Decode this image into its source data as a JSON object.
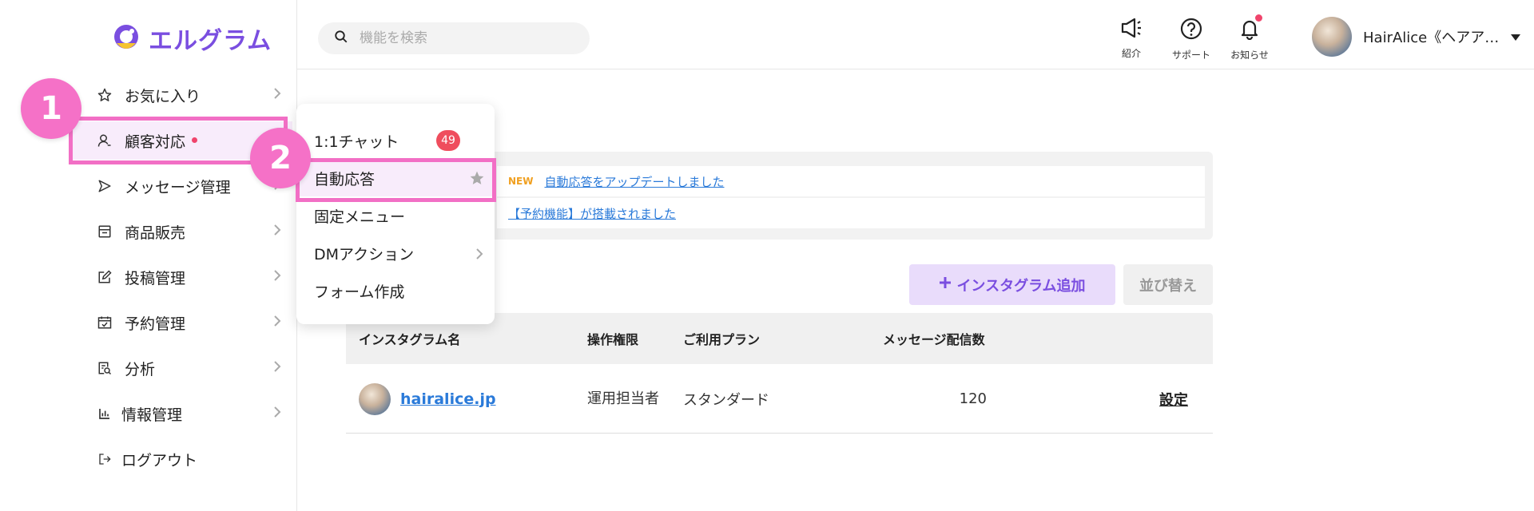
{
  "app": {
    "logo_text": "エルグラム"
  },
  "sidebar": {
    "items": [
      {
        "label": "お気に入り"
      },
      {
        "label": "顧客対応"
      },
      {
        "label": "メッセージ管理"
      },
      {
        "label": "商品販売"
      },
      {
        "label": "投稿管理"
      },
      {
        "label": "予約管理"
      },
      {
        "label": "分析"
      },
      {
        "label": "情報管理"
      },
      {
        "label": "ログアウト"
      }
    ]
  },
  "steps": {
    "one": "1",
    "two": "2"
  },
  "submenu": {
    "items": [
      {
        "label": "1:1チャット",
        "badge": "49"
      },
      {
        "label": "自動応答"
      },
      {
        "label": "固定メニュー"
      },
      {
        "label": "DMアクション"
      },
      {
        "label": "フォーム作成"
      }
    ]
  },
  "header": {
    "search_placeholder": "機能を検索",
    "intro_label": "紹介",
    "support_label": "サポート",
    "notice_label": "お知らせ",
    "user_name": "HairAlice《ヘアア…"
  },
  "notices": {
    "new_tag": "NEW",
    "item1": "自動応答をアップデートしました",
    "item2": "【予約機能】が搭載されました"
  },
  "actions": {
    "add_label": "インスタグラム追加",
    "sort_label": "並び替え"
  },
  "table": {
    "headers": [
      "インスタグラム名",
      "操作権限",
      "ご利用プラン",
      "メッセージ配信数"
    ],
    "rows": [
      {
        "name": "hairalice.jp",
        "role": "運用担当者",
        "plan": "スタンダード",
        "count": "120",
        "action": "設定"
      }
    ]
  },
  "colors": {
    "accent": "#7a4ee0",
    "highlight": "#f26fc5",
    "badge": "#ef4d5d",
    "link": "#2a7ad9"
  }
}
